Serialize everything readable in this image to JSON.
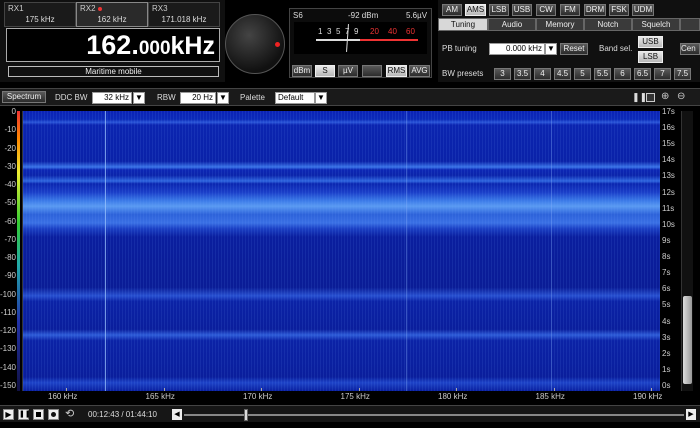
{
  "receivers": [
    {
      "label": "RX1",
      "freq": "175 kHz",
      "active": false
    },
    {
      "label": "RX2",
      "freq": "162 kHz",
      "active": true
    },
    {
      "label": "RX3",
      "freq": "171.018 kHz",
      "active": false
    }
  ],
  "frequency": {
    "main": "162.",
    "small": "000",
    "unit": "kHz"
  },
  "station": "Maritime mobile",
  "smeter": {
    "s_label": "S6",
    "dbm": "-92 dBm",
    "uv": "5.6µV",
    "scale": [
      "1",
      "3",
      "5",
      "7",
      "9",
      "20",
      "40",
      "60"
    ],
    "buttons": {
      "dbm": "dBm",
      "s": "S",
      "uv": "µV",
      "rms": "RMS",
      "avg": "AVG"
    }
  },
  "modes": [
    "AM",
    "AMS",
    "LSB",
    "USB",
    "CW",
    "FM",
    "DRM",
    "FSK",
    "UDM"
  ],
  "active_mode": "AMS",
  "panel_tabs": [
    "Tuning",
    "Audio",
    "Memory",
    "Notch",
    "Squelch"
  ],
  "pb_tuning": {
    "label": "PB tuning",
    "value": "0.000 kHz",
    "reset": "Reset"
  },
  "band_sel": {
    "label": "Band sel.",
    "upper": "USB",
    "lower": "LSB",
    "cen": "Cen"
  },
  "bw_presets": {
    "label": "BW presets",
    "values": [
      "3",
      "3.5",
      "4",
      "4.5",
      "5",
      "5.5",
      "6",
      "6.5",
      "7",
      "7.5"
    ]
  },
  "toolbar": {
    "spectrum": "Spectrum",
    "ddc_label": "DDC BW",
    "ddc_value": "32 kHz",
    "rbw_label": "RBW",
    "rbw_value": "20 Hz",
    "palette_label": "Palette",
    "palette_value": "Default"
  },
  "y_axis": [
    "0",
    "-10",
    "-20",
    "-30",
    "-40",
    "-50",
    "-60",
    "-70",
    "-80",
    "-90",
    "-100",
    "-110",
    "-120",
    "-130",
    "-140",
    "-150"
  ],
  "time_axis": [
    "17s",
    "16s",
    "15s",
    "14s",
    "13s",
    "12s",
    "11s",
    "10s",
    "9s",
    "8s",
    "7s",
    "6s",
    "5s",
    "4s",
    "3s",
    "2s",
    "1s",
    "0s"
  ],
  "x_axis": [
    "160 kHz",
    "165 kHz",
    "170 kHz",
    "175 kHz",
    "180 kHz",
    "185 kHz",
    "190 kHz"
  ],
  "playback": {
    "time": "00:12:43 / 01:44:10"
  }
}
